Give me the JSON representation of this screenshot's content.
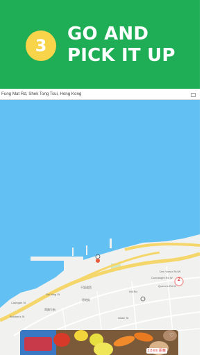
{
  "banner": {
    "step_number": "3",
    "headline_line1": "GO AND",
    "headline_line2": "PICK IT UP",
    "background_color": "#1fae55",
    "circle_color": "#f7d44a"
  },
  "address_bar": {
    "text": "Fung Mat Rd, Shek Tong Tsui, Hong Kong"
  },
  "map": {
    "water_color": "#62c1f2",
    "land_color": "#f1f1ef",
    "road_color": "#f5d66b",
    "cluster_count": "2",
    "street_labels": [
      "Des Voeux Rd W",
      "Queen's Rd W",
      "Connaught Rd W",
      "屈地街",
      "干諾道西",
      "Hill Rd",
      "Water St",
      "Sai Ning St",
      "Cadogan St",
      "卑路乍街",
      "Belcher's St"
    ]
  },
  "listing": {
    "distance_badge": "2.8 km 距離",
    "favorite_icon": "heart-icon"
  }
}
